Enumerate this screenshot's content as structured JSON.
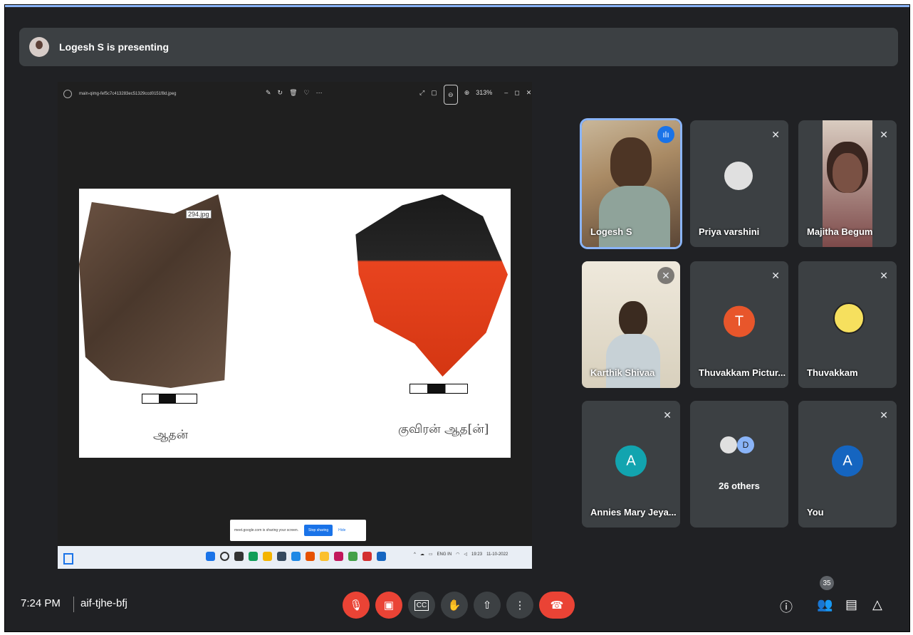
{
  "banner": {
    "title": "Logesh S is presenting"
  },
  "viewer": {
    "filename": "main-qimg-fef5c7c413283ec51329ccd0151f8d.jpeg",
    "zoom": "313%"
  },
  "shared_image": {
    "file_tag": "294.jpg",
    "caption_left": "ஆதன்",
    "caption_right": "குவிரன் ஆத[ன்]"
  },
  "share_notice": {
    "text": "meet.google.com is sharing your screen.",
    "stop_label": "Stop sharing",
    "hide_label": "Hide"
  },
  "taskbar": {
    "lang": "ENG IN",
    "time": "19:23",
    "date": "11-10-2022"
  },
  "participants": [
    {
      "name": "Logesh S",
      "speaking": true
    },
    {
      "name": "Priya varshini",
      "muted": true
    },
    {
      "name": "Majitha Begum",
      "muted": true
    },
    {
      "name": "Karthik Shivaa",
      "muted": true
    },
    {
      "name": "Thuvakkam Pictur...",
      "initial": "T",
      "color": "#e8562b",
      "muted": true
    },
    {
      "name": "Thuvakkam",
      "muted": true
    },
    {
      "name": "Annies Mary Jeya...",
      "initial": "A",
      "color": "#12a4af",
      "muted": true
    },
    {
      "name": "26 others",
      "initial": "D"
    },
    {
      "name": "You",
      "initial": "A",
      "color": "#1565c0",
      "muted": true
    }
  ],
  "meeting": {
    "time": "7:24 PM",
    "code": "aif-tjhe-bfj",
    "participant_count": "35"
  }
}
